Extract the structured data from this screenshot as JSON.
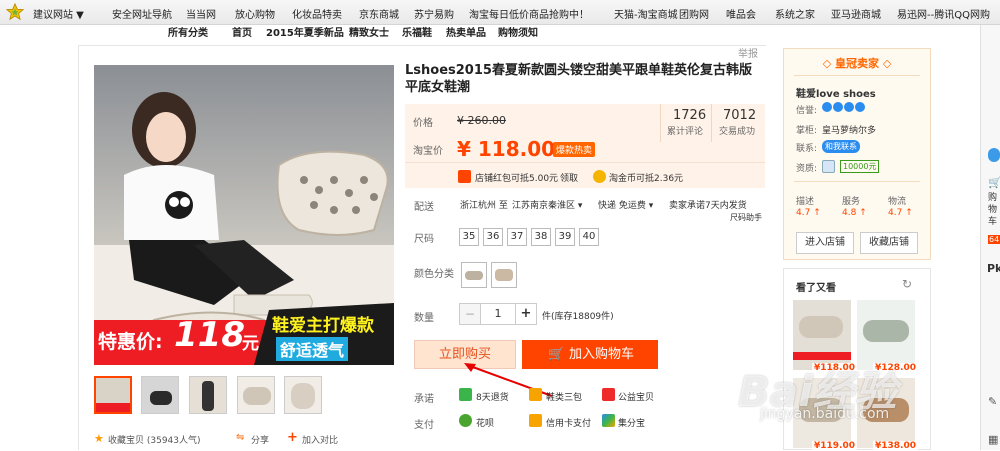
{
  "topbar": {
    "items": [
      "建议网站",
      "安全网址导航",
      "当当网",
      "放心购物",
      "化妆品特卖",
      "京东商城",
      "苏宁易购",
      "淘宝每日低价商品抢购中！",
      "天猫-淘宝商城",
      "团购网",
      "唯品会",
      "系统之家",
      "亚马逊商城",
      "易迅网--腾讯QQ网购"
    ]
  },
  "storenav": {
    "items": [
      "所有分类",
      "首页",
      "2015年夏季新品",
      "精致女士",
      "乐福鞋",
      "热卖单品",
      "购物须知"
    ]
  },
  "report_label": "举报",
  "product": {
    "title": "Lshoes2015春夏新款圆头镂空甜美平跟单鞋英伦复古韩版平底女鞋潮",
    "banner_price_label": "特惠价:",
    "banner_price": "118",
    "banner_unit": "元",
    "banner_slogan1": "鞋爱主打爆款",
    "banner_slogan2": "舒适透气"
  },
  "price": {
    "orig_label": "价格",
    "orig_value": "¥ 260.00",
    "review_count": "1726",
    "review_label": "累计评论",
    "sales_count": "7012",
    "sales_label": "交易成功",
    "tb_label": "淘宝价",
    "tb_value": "¥ 118.00",
    "hot_badge": "爆款热卖",
    "coupon1": "店铺红包可抵5.00元",
    "coupon1_action": "领取",
    "coupon2": "淘金币可抵2.36元"
  },
  "shipping": {
    "label": "配送",
    "from": "浙江杭州 至",
    "to": "江苏南京秦淮区",
    "express": "快递 免运费",
    "promise": "卖家承诺7天内发货",
    "size_help": "尺码助手"
  },
  "size": {
    "label": "尺码",
    "options": [
      "35",
      "36",
      "37",
      "38",
      "39",
      "40"
    ]
  },
  "color": {
    "label": "颜色分类"
  },
  "quantity": {
    "label": "数量",
    "value": "1",
    "minus": "−",
    "plus": "+",
    "stock": "件(库存18809件)"
  },
  "actions": {
    "buy_now": "立即购买",
    "add_cart": "加入购物车"
  },
  "promise": {
    "label": "承诺",
    "items": [
      "8天退货",
      "鞋类三包",
      "公益宝贝"
    ]
  },
  "payment": {
    "label": "支付",
    "items": [
      "花呗",
      "信用卡支付",
      "集分宝"
    ]
  },
  "social": {
    "favorite": "收藏宝贝 (35943人气)",
    "share": "分享",
    "compare": "加入对比"
  },
  "seller": {
    "header": "皇冠卖家",
    "shop_name": "鞋爱love shoes",
    "credit_label": "信誉:",
    "keeper_label": "掌柜:",
    "keeper_name": "皇马萝纳尔多",
    "contact_label": "联系:",
    "contact_badge": "和我联系",
    "qual_label": "资质:",
    "deposit": "10000元",
    "ratings": [
      {
        "label": "描述",
        "value": "4.7"
      },
      {
        "label": "服务",
        "value": "4.8"
      },
      {
        "label": "物流",
        "value": "4.7"
      }
    ],
    "enter_shop": "进入店铺",
    "fav_shop": "收藏店铺"
  },
  "also_viewed": {
    "title": "看了又看",
    "refresh_icon": "refresh-icon",
    "prices": [
      "¥118.00",
      "¥128.00",
      "¥119.00",
      "¥138.00"
    ]
  },
  "right_sidebar": {
    "cart_label": "购物车",
    "cart_count": "64",
    "pk": "Pk"
  },
  "watermark": {
    "text": "Bai经验",
    "sub": "jingyan.baidu.com"
  },
  "colors": {
    "accent": "#ff4400",
    "pricebg": "#fff2e8",
    "buybg": "#ffe4d0"
  }
}
